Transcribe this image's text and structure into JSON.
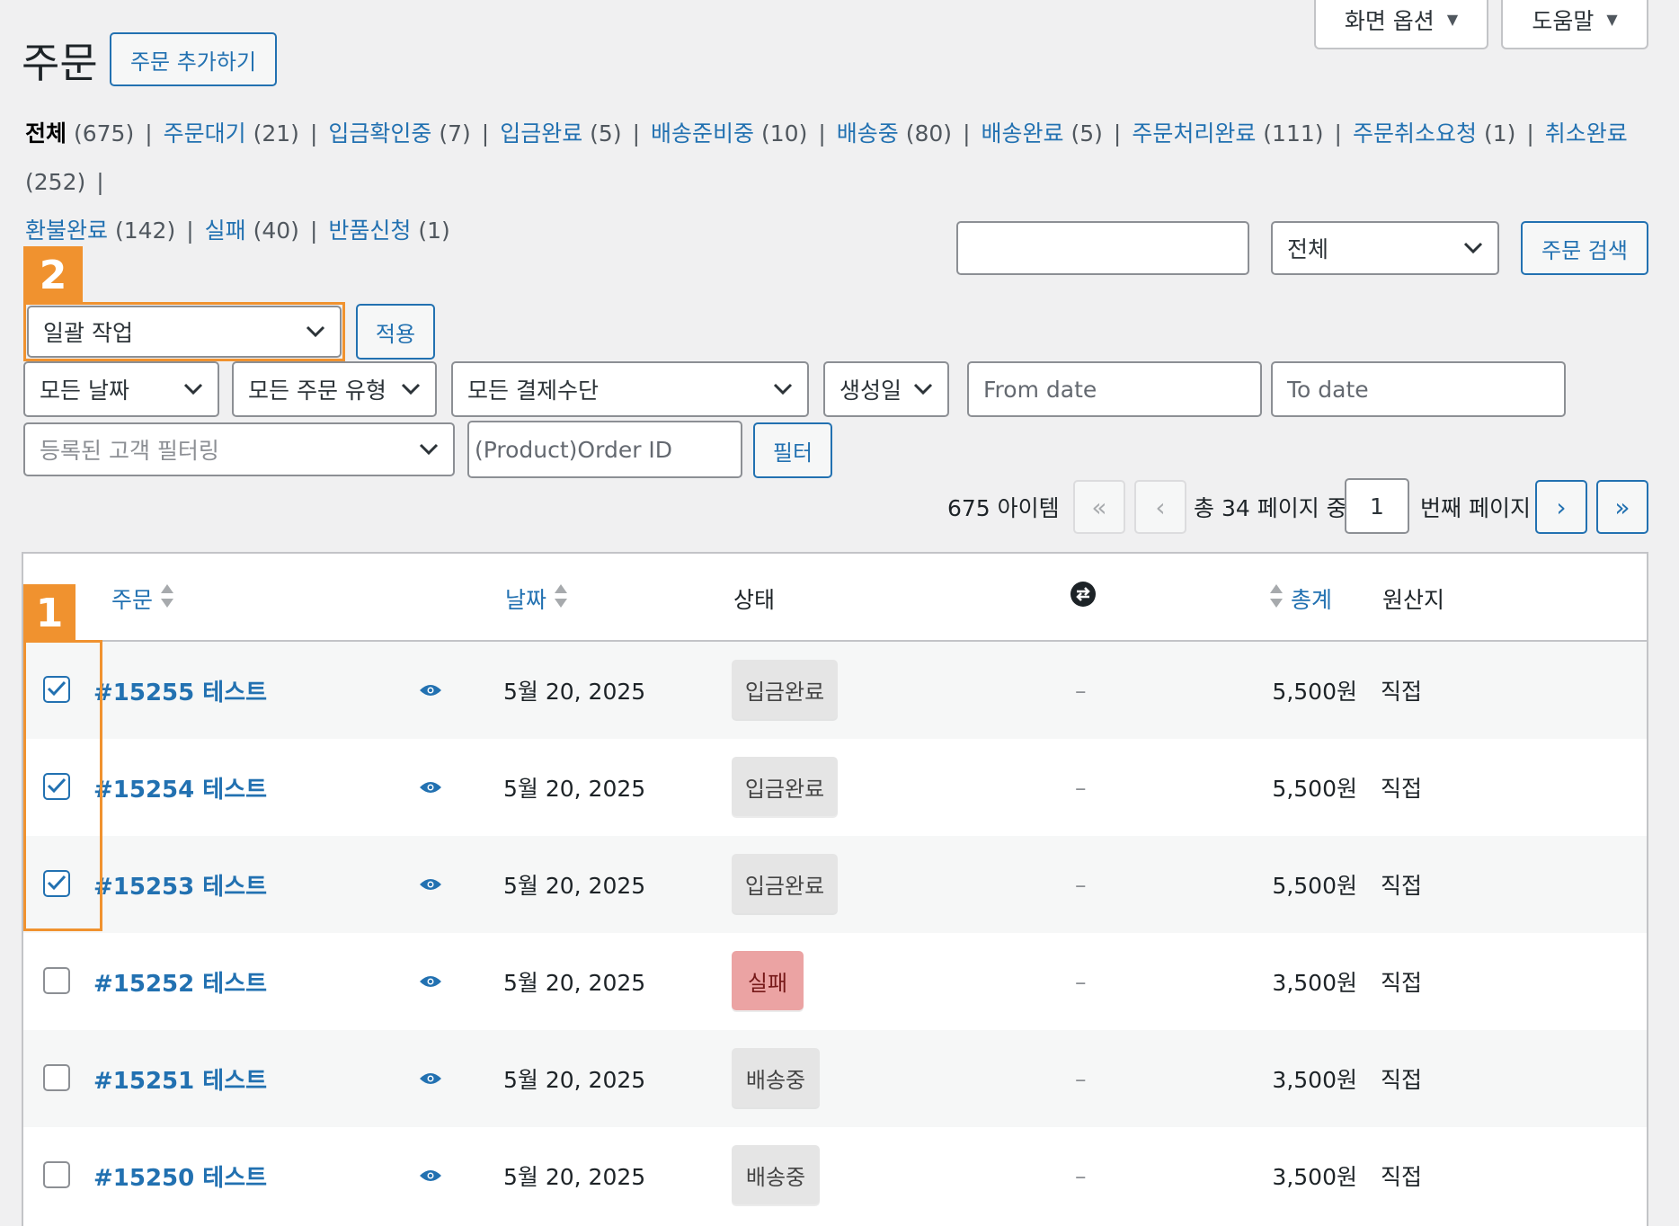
{
  "top_tabs": {
    "screen_options": "화면 옵션",
    "help": "도움말"
  },
  "header": {
    "title": "주문",
    "add_order": "주문 추가하기"
  },
  "status_filters": [
    {
      "label": "전체",
      "count": "(675)",
      "current": true
    },
    {
      "label": "주문대기",
      "count": "(21)"
    },
    {
      "label": "입금확인중",
      "count": "(7)"
    },
    {
      "label": "입금완료",
      "count": "(5)"
    },
    {
      "label": "배송준비중",
      "count": "(10)"
    },
    {
      "label": "배송중",
      "count": "(80)"
    },
    {
      "label": "배송완료",
      "count": "(5)"
    },
    {
      "label": "주문처리완료",
      "count": "(111)"
    },
    {
      "label": "주문취소요청",
      "count": "(1)"
    },
    {
      "label": "취소완료",
      "count": "(252)"
    },
    {
      "label": "환불완료",
      "count": "(142)"
    },
    {
      "label": "실패",
      "count": "(40)"
    },
    {
      "label": "반품신청",
      "count": "(1)"
    }
  ],
  "search": {
    "input_value": "",
    "scope_select": "전체",
    "button": "주문 검색"
  },
  "annotations": {
    "marker_1": "1",
    "marker_2": "2"
  },
  "bulk": {
    "select": "일괄 작업",
    "apply": "적용"
  },
  "filters": {
    "date": "모든 날짜",
    "order_type": "모든 주문 유형",
    "payment": "모든 결제수단",
    "created": "생성일",
    "from_placeholder": "From date",
    "to_placeholder": "To date",
    "customer_placeholder": "등록된 고객 필터링",
    "order_id_placeholder": "(Product)Order ID",
    "filter_button": "필터"
  },
  "pagination": {
    "items": "675 아이템",
    "first": "«",
    "prev": "‹",
    "total_text": "총 34 페이지 중",
    "current_page": "1",
    "page_suffix": "번째 페이지",
    "next": "›",
    "last": "»"
  },
  "table": {
    "columns": {
      "order": "주문",
      "date": "날짜",
      "status": "상태",
      "total": "총계",
      "origin": "원산지"
    },
    "rows": [
      {
        "order": "#15255 테스트",
        "date": "5월 20, 2025",
        "status": "입금완료",
        "status_type": "gray",
        "sub": "–",
        "total": "5,500원",
        "origin": "직접",
        "checked": true
      },
      {
        "order": "#15254 테스트",
        "date": "5월 20, 2025",
        "status": "입금완료",
        "status_type": "gray",
        "sub": "–",
        "total": "5,500원",
        "origin": "직접",
        "checked": true
      },
      {
        "order": "#15253 테스트",
        "date": "5월 20, 2025",
        "status": "입금완료",
        "status_type": "gray",
        "sub": "–",
        "total": "5,500원",
        "origin": "직접",
        "checked": true
      },
      {
        "order": "#15252 테스트",
        "date": "5월 20, 2025",
        "status": "실패",
        "status_type": "red",
        "sub": "–",
        "total": "3,500원",
        "origin": "직접",
        "checked": false
      },
      {
        "order": "#15251 테스트",
        "date": "5월 20, 2025",
        "status": "배송중",
        "status_type": "gray",
        "sub": "–",
        "total": "3,500원",
        "origin": "직접",
        "checked": false
      },
      {
        "order": "#15250 테스트",
        "date": "5월 20, 2025",
        "status": "배송중",
        "status_type": "gray",
        "sub": "–",
        "total": "3,500원",
        "origin": "직접",
        "checked": false
      }
    ]
  },
  "colors": {
    "accent": "#2271b1",
    "highlight": "#f0922f",
    "failed_bg": "#eba3a3"
  }
}
